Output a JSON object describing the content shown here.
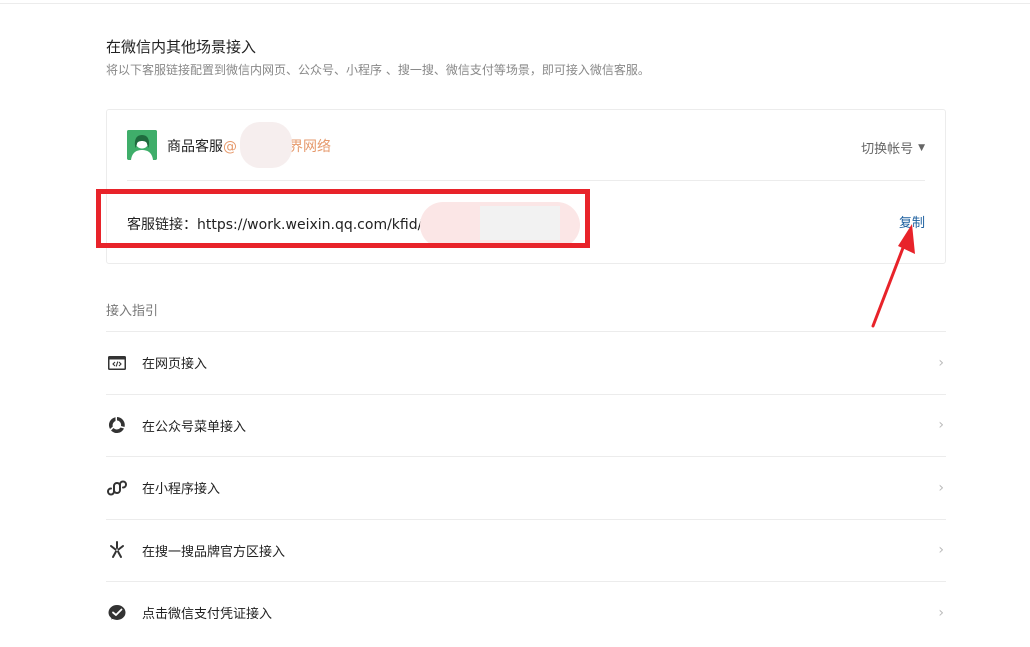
{
  "section": {
    "title": "在微信内其他场景接入",
    "description": "将以下客服链接配置到微信内网页、公众号、小程序 、搜一搜、微信支付等场景，即可接入微信客服。"
  },
  "account": {
    "name_prefix": "商品客服",
    "name_org": "@",
    "name_org_suffix": "界网络",
    "switch_label": "切换帐号",
    "caret": "▼"
  },
  "link": {
    "label": "客服链接：https://work.weixin.qq.com/kfid/kf",
    "copy_label": "复制"
  },
  "guide": {
    "title": "接入指引",
    "items": [
      {
        "label": "在网页接入",
        "icon": "webpage-code-icon"
      },
      {
        "label": "在公众号菜单接入",
        "icon": "official-account-icon"
      },
      {
        "label": "在小程序接入",
        "icon": "mini-program-icon"
      },
      {
        "label": "在搜一搜品牌官方区接入",
        "icon": "search-sparkle-icon"
      },
      {
        "label": "点击微信支付凭证接入",
        "icon": "wechat-pay-icon"
      }
    ],
    "chevron": "›"
  },
  "colors": {
    "highlight": "#e8232a",
    "link": "#1b5e9e",
    "avatar": "#3fae6a",
    "org_text": "#e69a6d"
  }
}
